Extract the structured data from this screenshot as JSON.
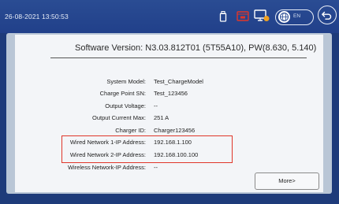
{
  "header": {
    "datetime": "26-08-2021 13:50:53",
    "icons": [
      "usb-icon",
      "alarm-icon",
      "monitor-icon",
      "globe-icon",
      "back-icon"
    ],
    "language_label": "EN"
  },
  "info": {
    "software_version": "Software Version:  N3.03.812T01 (5T55A10), PW(8.630, 5.140)",
    "rows": [
      {
        "label": "System Model:",
        "value": "Test_ChargeModel"
      },
      {
        "label": "Charge Point SN:",
        "value": "Test_123456"
      },
      {
        "label": "Output Voltage:",
        "value": "--"
      },
      {
        "label": "Output Current Max:",
        "value": "251 A"
      },
      {
        "label": "Charger ID:",
        "value": "Charger123456"
      },
      {
        "label": "Wired Network 1-IP Address:",
        "value": "192.168.1.100"
      },
      {
        "label": "Wired Network 2-IP Address:",
        "value": "192.168.100.100"
      },
      {
        "label": "Wireless Network-IP Address:",
        "value": "--"
      }
    ]
  },
  "actions": {
    "more_label": "More>"
  },
  "colors": {
    "header_bg": "#21408a",
    "panel_bg": "#b9c6d6",
    "card_bg": "#f3f5f8",
    "highlight": "#e0362a",
    "alarm": "#e0362a",
    "monitor_badge": "#f0a020"
  }
}
